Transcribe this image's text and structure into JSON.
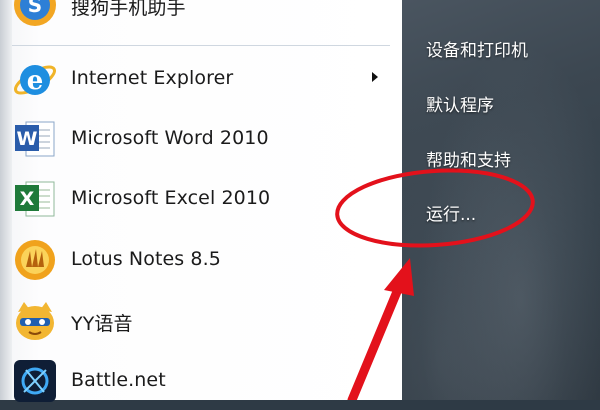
{
  "programs": [
    {
      "label": "搜狗手机助手",
      "icon": "sogou-icon"
    },
    {
      "label": "Internet Explorer",
      "icon": "ie-icon"
    },
    {
      "label": "Microsoft Word 2010",
      "icon": "word-icon"
    },
    {
      "label": "Microsoft Excel 2010",
      "icon": "excel-icon"
    },
    {
      "label": "Lotus Notes 8.5",
      "icon": "lotus-notes-icon"
    },
    {
      "label": "YY语音",
      "icon": "yy-icon"
    },
    {
      "label": "Battle.net",
      "icon": "battlenet-icon"
    }
  ],
  "right_menu": [
    {
      "label": "设备和打印机"
    },
    {
      "label": "默认程序"
    },
    {
      "label": "帮助和支持"
    },
    {
      "label": "运行..."
    }
  ],
  "annotation": {
    "color": "#e3111b",
    "highlighted": "运行..."
  }
}
